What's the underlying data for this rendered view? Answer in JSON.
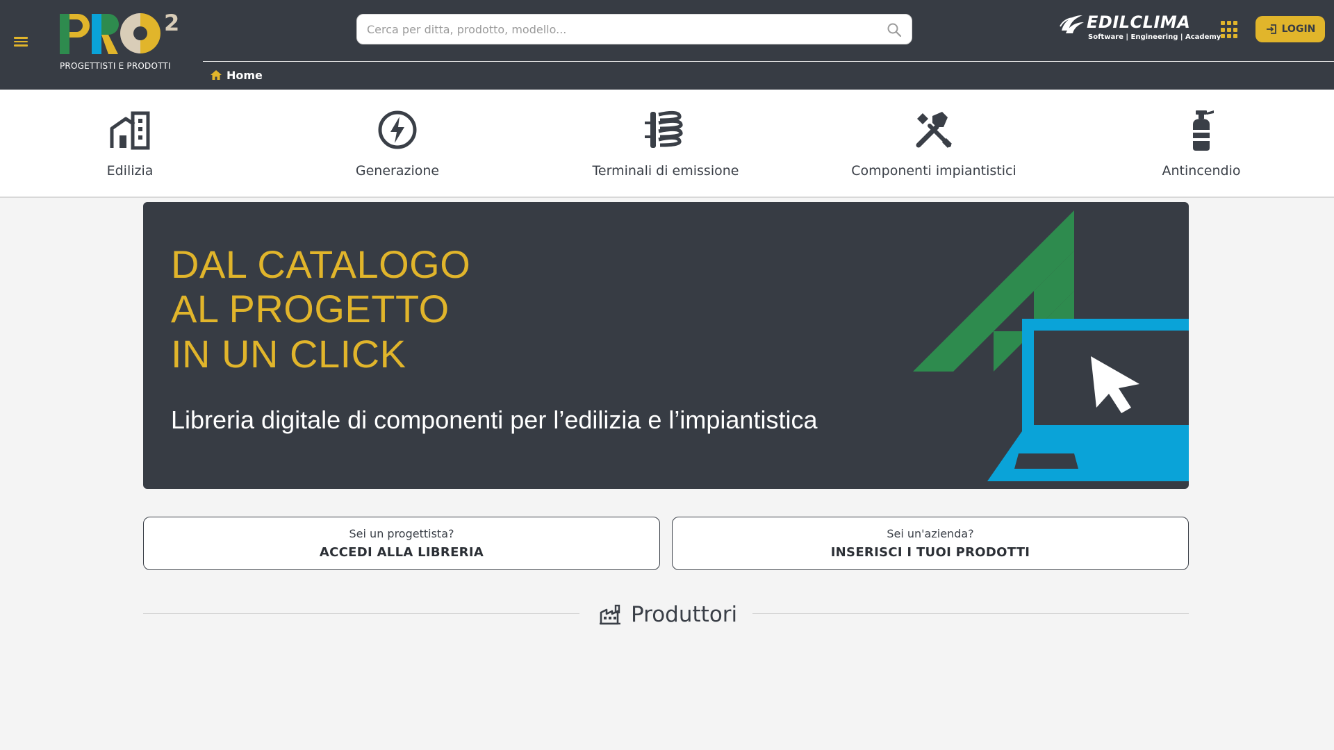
{
  "header": {
    "logo_subtitle": "PROGETTISTI E PRODOTTI",
    "search_placeholder": "Cerca per ditta, prodotto, modello...",
    "breadcrumb": "Home",
    "brand_name": "EDILCLIMA",
    "brand_tagline": "Software | Engineering | Academy",
    "login_label": "LOGIN"
  },
  "categories": [
    {
      "label": "Edilizia",
      "icon": "building-icon"
    },
    {
      "label": "Generazione",
      "icon": "lightning-bolt-icon"
    },
    {
      "label": "Terminali di emissione",
      "icon": "radiator-icon"
    },
    {
      "label": "Componenti impiantistici",
      "icon": "tools-icon"
    },
    {
      "label": "Antincendio",
      "icon": "fire-extinguisher-icon"
    }
  ],
  "hero": {
    "lines": [
      "DAL CATALOGO",
      "AL PROGETTO",
      "IN UN CLICK"
    ],
    "subtitle": "Libreria digitale di componenti per l’edilizia e l’impiantistica"
  },
  "cta": {
    "designer": {
      "question": "Sei un progettista?",
      "action": "ACCEDI ALLA LIBRERIA"
    },
    "company": {
      "question": "Sei un'azienda?",
      "action": "INSERISCI I TUOI PRODOTTI"
    }
  },
  "section": {
    "title": "Produttori",
    "icon": "factory-icon"
  },
  "colors": {
    "header_bg": "#373c44",
    "accent_yellow": "#e1b52b",
    "accent_green": "#2e8b4e",
    "accent_blue": "#0aa3d8",
    "page_bg": "#f4f4f4"
  }
}
